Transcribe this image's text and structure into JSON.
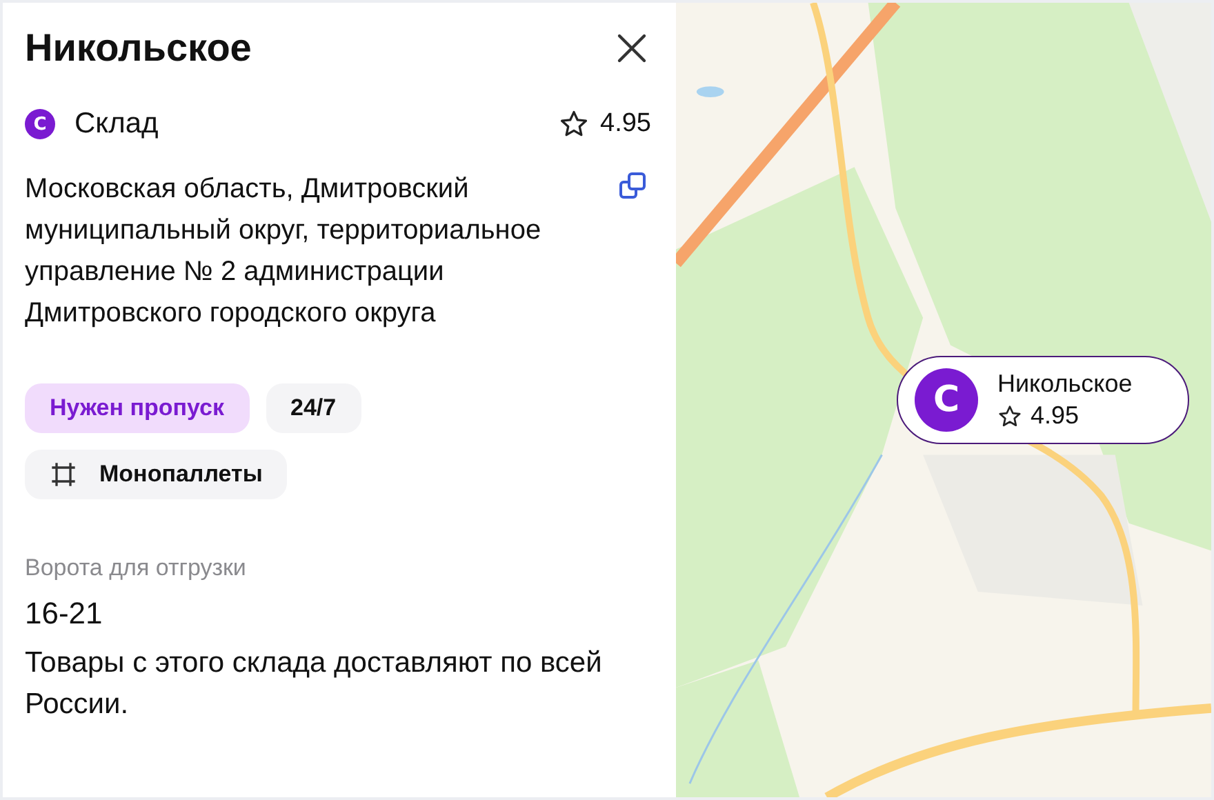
{
  "panel": {
    "title": "Никольское",
    "type_icon_letter": "С",
    "type": "Склад",
    "rating": "4.95",
    "address": "Московская область, Дмитровский муниципальный округ, территориальное управление № 2 администрации Дмитровского городского округа",
    "tags": [
      {
        "label": "Нужен пропуск",
        "kind": "accent"
      },
      {
        "label": "24/7",
        "kind": "plain"
      },
      {
        "label": "Монопаллеты",
        "kind": "icon"
      }
    ],
    "gates_label": "Ворота для отгрузки",
    "gates": "16-21",
    "note": "Товары с этого склада доставляют по всей России."
  },
  "map": {
    "kind": "picture",
    "marker": {
      "letter": "С",
      "title": "Никольское",
      "rating": "4.95"
    }
  }
}
